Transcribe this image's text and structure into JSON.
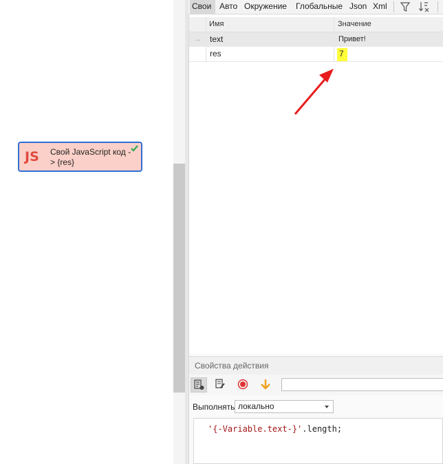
{
  "canvas": {
    "node": {
      "logo": "JS",
      "title": "Свой JavaScript код -> {res}",
      "status_icon": "check-icon"
    }
  },
  "tabs": [
    {
      "label": "Свои",
      "active": true
    },
    {
      "label": "Авто",
      "active": false
    },
    {
      "label": "Окружение",
      "active": false
    },
    {
      "label": "Глобальные",
      "active": false
    },
    {
      "label": "Json",
      "active": false
    },
    {
      "label": "Xml",
      "active": false
    }
  ],
  "toolbar_icons": [
    "filter-icon",
    "sort-clear-icon"
  ],
  "grid": {
    "columns": [
      "Имя",
      "Значение"
    ],
    "rows": [
      {
        "indicator": "→",
        "name": "text",
        "value": "Привет!",
        "selected": true
      },
      {
        "indicator": "",
        "name": "res",
        "value": "7",
        "selected": false,
        "highlight": true
      }
    ]
  },
  "properties": {
    "title": "Свойства действия",
    "toolbar_icons": [
      "properties-icon",
      "edit-icon",
      "record-icon",
      "down-arrow-icon"
    ],
    "execute_label": "Выполнять",
    "execute_value": "локально",
    "code_string": "'{-Variable.text-}'",
    "code_rest": ".length;"
  },
  "colors": {
    "node_fill": "#fbd0c8",
    "node_border": "#2f6fd6",
    "highlight": "#ffff3a",
    "annotation_arrow": "#e81c1c"
  }
}
